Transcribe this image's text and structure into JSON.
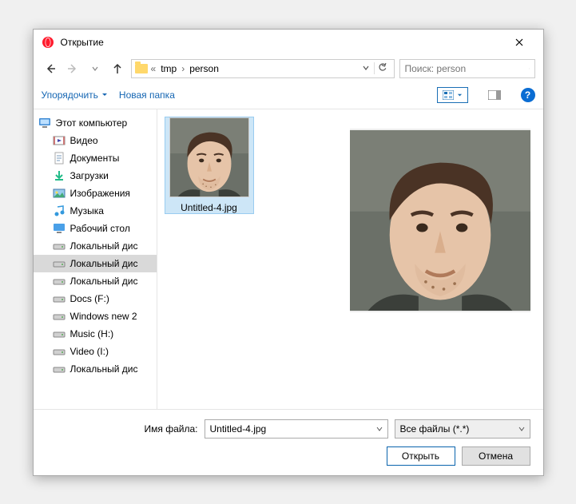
{
  "title": "Открытие",
  "breadcrumb": {
    "seg1": "tmp",
    "seg2": "person"
  },
  "search": {
    "placeholder": "Поиск: person"
  },
  "toolbar": {
    "organize": "Упорядочить",
    "newfolder": "Новая папка"
  },
  "tree": {
    "root": "Этот компьютер",
    "items": [
      {
        "label": "Видео",
        "icon": "video"
      },
      {
        "label": "Документы",
        "icon": "doc"
      },
      {
        "label": "Загрузки",
        "icon": "download"
      },
      {
        "label": "Изображения",
        "icon": "image"
      },
      {
        "label": "Музыка",
        "icon": "music"
      },
      {
        "label": "Рабочий стол",
        "icon": "desktop"
      },
      {
        "label": "Локальный дис",
        "icon": "drive"
      },
      {
        "label": "Локальный дис",
        "icon": "drive",
        "selected": true
      },
      {
        "label": "Локальный дис",
        "icon": "drive"
      },
      {
        "label": "Docs (F:)",
        "icon": "drive"
      },
      {
        "label": "Windows new 2",
        "icon": "drive"
      },
      {
        "label": "Music (H:)",
        "icon": "drive"
      },
      {
        "label": "Video (I:)",
        "icon": "drive"
      },
      {
        "label": "Локальный дис",
        "icon": "drive"
      }
    ]
  },
  "files": {
    "item0": "Untitled-4.jpg"
  },
  "footer": {
    "filename_label": "Имя файла:",
    "filename_value": "Untitled-4.jpg",
    "filter": "Все файлы (*.*)",
    "open": "Открыть",
    "cancel": "Отмена"
  }
}
